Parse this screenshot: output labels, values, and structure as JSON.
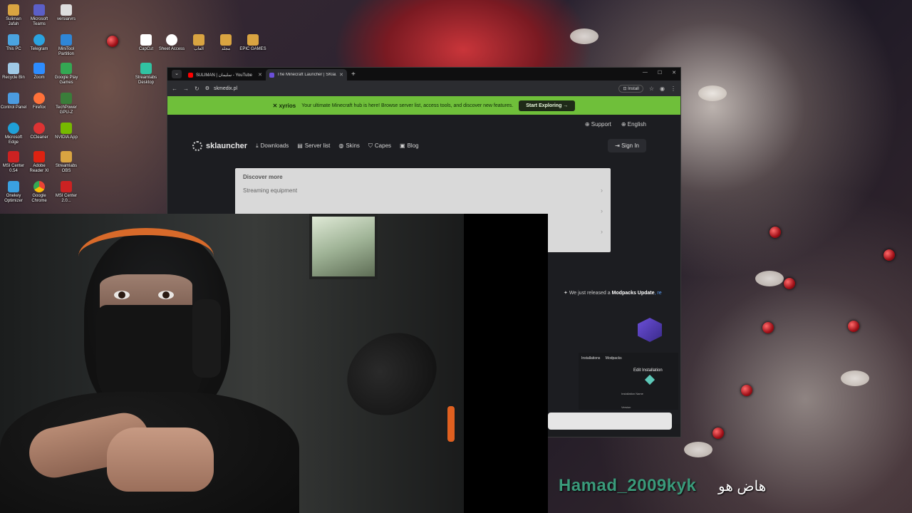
{
  "desktop": {
    "icons": [
      {
        "label": "Suliman Jafah",
        "color": "#d9a441"
      },
      {
        "label": "Microsoft Teams",
        "color": "#5b5fc7"
      },
      {
        "label": "versiarvrs",
        "color": "#dddddd"
      },
      {
        "label": "This PC",
        "color": "#4aa3df"
      },
      {
        "label": "Telegram",
        "color": "#2aa3e0"
      },
      {
        "label": "MiniTool Partition",
        "color": "#2f86d6"
      },
      {
        "label": "CapCut",
        "color": "#ffffff"
      },
      {
        "label": "Recycle Bin",
        "color": "#9fc9e6"
      },
      {
        "label": "Zoom",
        "color": "#2d8cff"
      },
      {
        "label": "Google Play Games",
        "color": "#34a853"
      },
      {
        "label": "Streamlabs Desktop",
        "color": "#31c3a2"
      },
      {
        "label": "Control Panel",
        "color": "#4b9be0"
      },
      {
        "label": "Firefox",
        "color": "#ff7139"
      },
      {
        "label": "TechPower GPU-Z",
        "color": "#3a7d3a"
      },
      {
        "label": "Microsoft Edge",
        "color": "#1fa0d8"
      },
      {
        "label": "CCleaner",
        "color": "#d33"
      },
      {
        "label": "NVIDIA App",
        "color": "#76b900"
      },
      {
        "label": "MSI Center 0.54",
        "color": "#c22"
      },
      {
        "label": "Adobe Reader XI",
        "color": "#d21"
      },
      {
        "label": "Streamlabs OBS",
        "color": "#d9a441"
      },
      {
        "label": "Onekey Optimizer",
        "color": "#3aa0e0"
      },
      {
        "label": "Google Chrome",
        "color": "#fbbc05"
      },
      {
        "label": "MSI Center 2.0...",
        "color": "#c22"
      },
      {
        "label": "Sheet Access",
        "color": "#ffffff"
      },
      {
        "label": "العاب",
        "color": "#d9a441"
      },
      {
        "label": "مجلد",
        "color": "#d9a441"
      },
      {
        "label": "EPIC GAMES",
        "color": "#d9a441"
      }
    ]
  },
  "browser": {
    "tabs": [
      {
        "title": "SULIMAN | سليمان - YouTube",
        "favicon": "#ff0000"
      },
      {
        "title": "The Minecraft Launcher | SKlau",
        "favicon": "#6b4fd8"
      }
    ],
    "new_tab": "+",
    "window_controls": [
      "—",
      "☐",
      "✕"
    ],
    "url": "skmedix.pl",
    "install_label": "Install"
  },
  "promo": {
    "brand": "xyrios",
    "message": "Your ultimate Minecraft hub is here! Browse server list, access tools, and discover new features.",
    "cta": "Start Exploring →"
  },
  "site": {
    "support": "Support",
    "language": "English",
    "logo": "sklauncher",
    "nav": [
      "Downloads",
      "Server list",
      "Skins",
      "Capes",
      "Blog"
    ],
    "sign_in": "Sign In",
    "discover": {
      "heading": "Discover more",
      "items": [
        "Streaming equipment",
        "",
        ""
      ]
    },
    "release_prefix": "We just released a",
    "release_bold": "Modpacks Update",
    "release_link": ", re",
    "launcher_mock": {
      "tab1": "Installations",
      "tab2": "Modpacks",
      "title": "Edit Installation",
      "field1": "Installation Name",
      "field2": "Version"
    }
  },
  "chat": {
    "username": "Hamad_2009kyk",
    "message": "هاض هو"
  }
}
